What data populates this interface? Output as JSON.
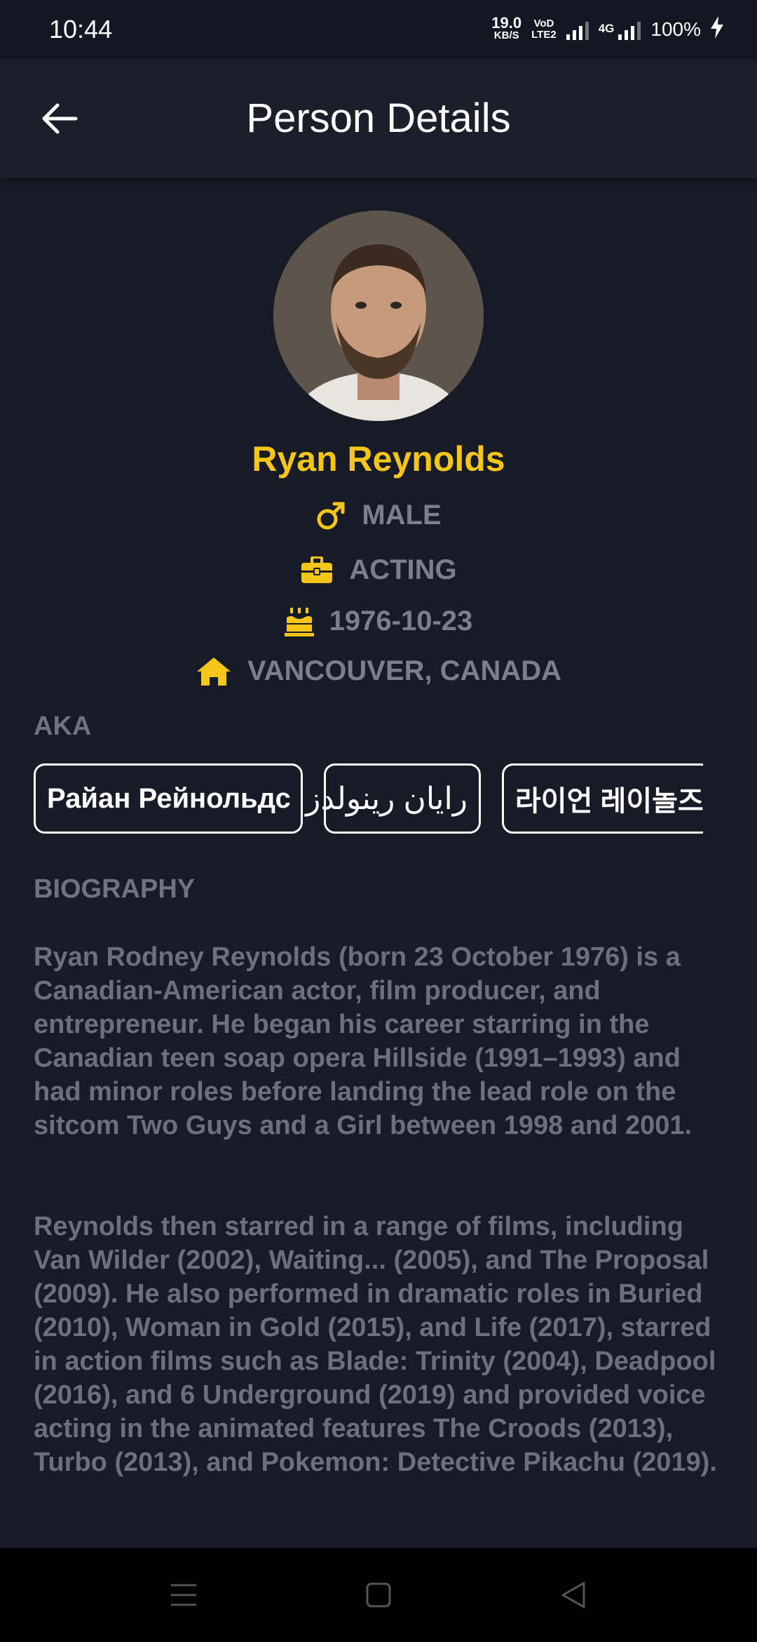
{
  "status": {
    "time": "10:44",
    "net_speed_value": "19.0",
    "net_speed_unit": "KB/S",
    "volte_top": "VoD",
    "volte_bottom": "LTE2",
    "network_type": "4G",
    "battery": "100%"
  },
  "header": {
    "title": "Person Details",
    "back_icon": "arrow-left-icon"
  },
  "person": {
    "name": "Ryan Reynolds",
    "gender": "MALE",
    "department": "ACTING",
    "birthday": "1976-10-23",
    "place_of_birth": "VANCOUVER, CANADA"
  },
  "aka": {
    "label": "AKA",
    "names": [
      "Райан Рейнольдс",
      "رایان رینولدز",
      "라이언 레이놀즈"
    ]
  },
  "biography": {
    "label": "BIOGRAPHY",
    "paragraph1": "Ryan Rodney Reynolds (born 23 October 1976) is a Canadian-American actor, film producer, and entrepreneur. He began his career starring in the Canadian teen soap opera Hillside (1991–1993) and had minor roles before landing the lead role on the sitcom Two Guys and a Girl between 1998 and 2001.",
    "paragraph2": "Reynolds then starred in a range of films, including Van Wilder (2002), Waiting... (2005), and The Proposal (2009). He also performed in dramatic roles in Buried (2010), Woman in Gold (2015), and Life (2017), starred in action films such as Blade: Trinity (2004), Deadpool (2016), and 6 Underground (2019) and provided voice acting in the animated features The Croods (2013), Turbo (2013), and Pokemon: Detective Pikachu (2019)."
  },
  "colors": {
    "background": "#161b26",
    "accent": "#f5c518",
    "muted_text": "#6b717c"
  },
  "icons": {
    "gender": "male-symbol-icon",
    "department": "briefcase-icon",
    "birthday": "birthday-cake-icon",
    "place": "home-icon"
  },
  "navigation": {
    "menu_icon": "menu-icon",
    "home_icon": "square-home-icon",
    "back_icon": "triangle-back-icon"
  }
}
